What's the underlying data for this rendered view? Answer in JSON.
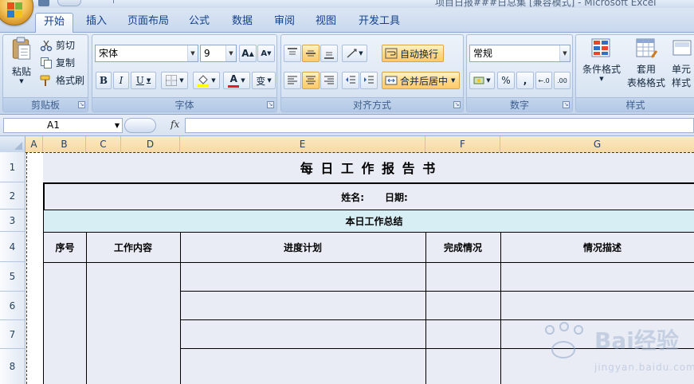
{
  "app": {
    "window_title": "项目日报###日总集 [兼容模式] - Microsoft Excel"
  },
  "tabs": [
    {
      "label": "开始",
      "active": true
    },
    {
      "label": "插入"
    },
    {
      "label": "页面布局"
    },
    {
      "label": "公式"
    },
    {
      "label": "数据"
    },
    {
      "label": "审阅"
    },
    {
      "label": "视图"
    },
    {
      "label": "开发工具"
    }
  ],
  "ribbon": {
    "clipboard": {
      "label": "剪贴板",
      "paste": "粘贴",
      "cut": "剪切",
      "copy": "复制",
      "format_painter": "格式刷"
    },
    "font": {
      "label": "字体",
      "font_name": "宋体",
      "font_size": "9",
      "bold": "B",
      "italic": "I",
      "underline": "U",
      "grow": "A",
      "shrink": "A",
      "font_color_letter": "A",
      "phonetic": "变"
    },
    "alignment": {
      "label": "对齐方式",
      "wrap_text": "自动换行",
      "merge_center": "合并后居中"
    },
    "number": {
      "label": "数字",
      "format": "常规",
      "percent": "%",
      "comma": ","
    },
    "styles": {
      "label": "样式",
      "conditional": "条件格式",
      "table_format_1": "套用",
      "table_format_2": "表格格式",
      "cell_styles_1": "单元",
      "cell_styles_2": "样式"
    }
  },
  "formula_bar": {
    "name_box": "A1",
    "fx": "fx",
    "formula": ""
  },
  "columns": [
    "A",
    "B",
    "C",
    "D",
    "E",
    "F",
    "G"
  ],
  "rows": [
    "1",
    "2",
    "3",
    "4",
    "5",
    "6",
    "7",
    "8"
  ],
  "sheet": {
    "title": "每 日 工 作 报 告 书",
    "name_label": "姓名:",
    "date_label": "日期:",
    "summary_header": "本日工作总结",
    "headers": [
      "序号",
      "工作内容",
      "进度计划",
      "完成情况",
      "情况描述"
    ]
  },
  "colors": {
    "summary_band": "#d6eef4",
    "sheet_bg": "#e9ecf5",
    "selection_col": "#f7d9a4"
  },
  "watermark": {
    "brand": "Bai经验",
    "url": "jingyan.baidu.com"
  }
}
